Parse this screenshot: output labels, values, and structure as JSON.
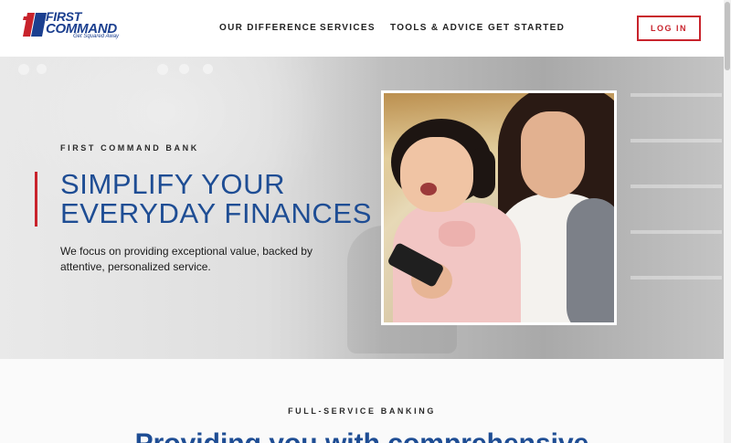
{
  "header": {
    "logo": {
      "line1": "FIRST",
      "line2": "COMMAND",
      "tagline": "Get Squared Away"
    },
    "nav": [
      "OUR DIFFERENCE",
      "SERVICES",
      "TOOLS & ADVICE",
      "GET STARTED"
    ],
    "login_label": "LOG IN"
  },
  "hero": {
    "eyebrow": "FIRST COMMAND BANK",
    "headline_line1": "SIMPLIFY YOUR",
    "headline_line2": "EVERYDAY FINANCES",
    "lede": "We focus on providing exceptional value, backed by attentive, personalized service."
  },
  "section": {
    "eyebrow": "FULL-SERVICE BANKING",
    "title": "Providing you with comprehensive"
  },
  "colors": {
    "brand_blue": "#1e4d94",
    "accent_red": "#c8232c"
  }
}
